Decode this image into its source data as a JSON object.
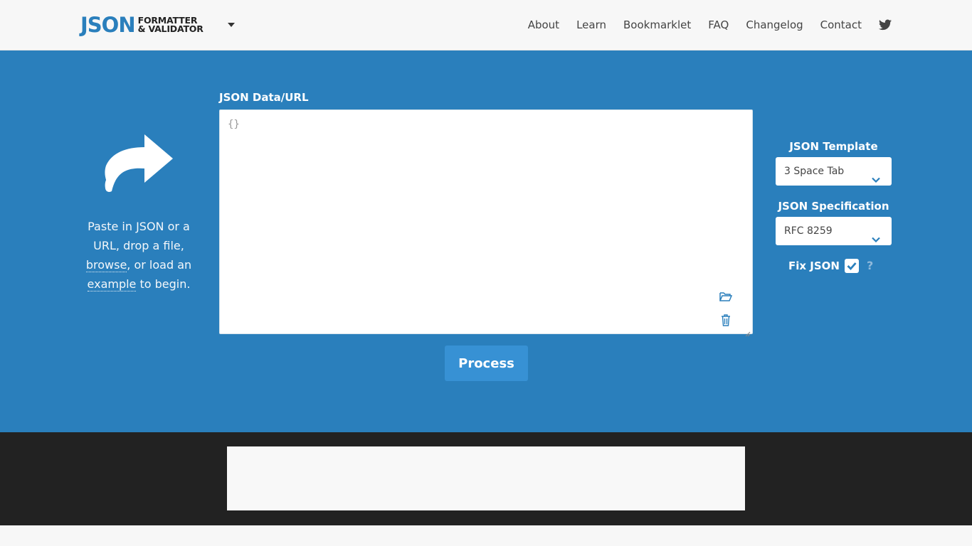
{
  "header": {
    "logo_main": "JSON",
    "logo_line1": "FORMATTER",
    "logo_line2": "& VALIDATOR",
    "nav": [
      "About",
      "Learn",
      "Bookmarklet",
      "FAQ",
      "Changelog",
      "Contact"
    ],
    "social_icon": "twitter-icon"
  },
  "intro": {
    "icon": "share-arrow-icon",
    "line1": "Paste in JSON or a URL, drop a file,",
    "browse": "browse",
    "mid": ", or load an",
    "example": "example",
    "end": " to begin."
  },
  "editor": {
    "label": "JSON Data/URL",
    "value": "{}",
    "open_icon": "folder-open-icon",
    "clear_icon": "trash-icon"
  },
  "process_label": "Process",
  "options": {
    "template_label": "JSON Template",
    "template_value": "3 Space Tab",
    "spec_label": "JSON Specification",
    "spec_value": "RFC 8259",
    "fix_label": "Fix JSON",
    "fix_checked": true,
    "help": "?"
  },
  "colors": {
    "brand_blue": "#2a7fbc",
    "button_blue": "#3791d4",
    "dark_band": "#222222"
  }
}
